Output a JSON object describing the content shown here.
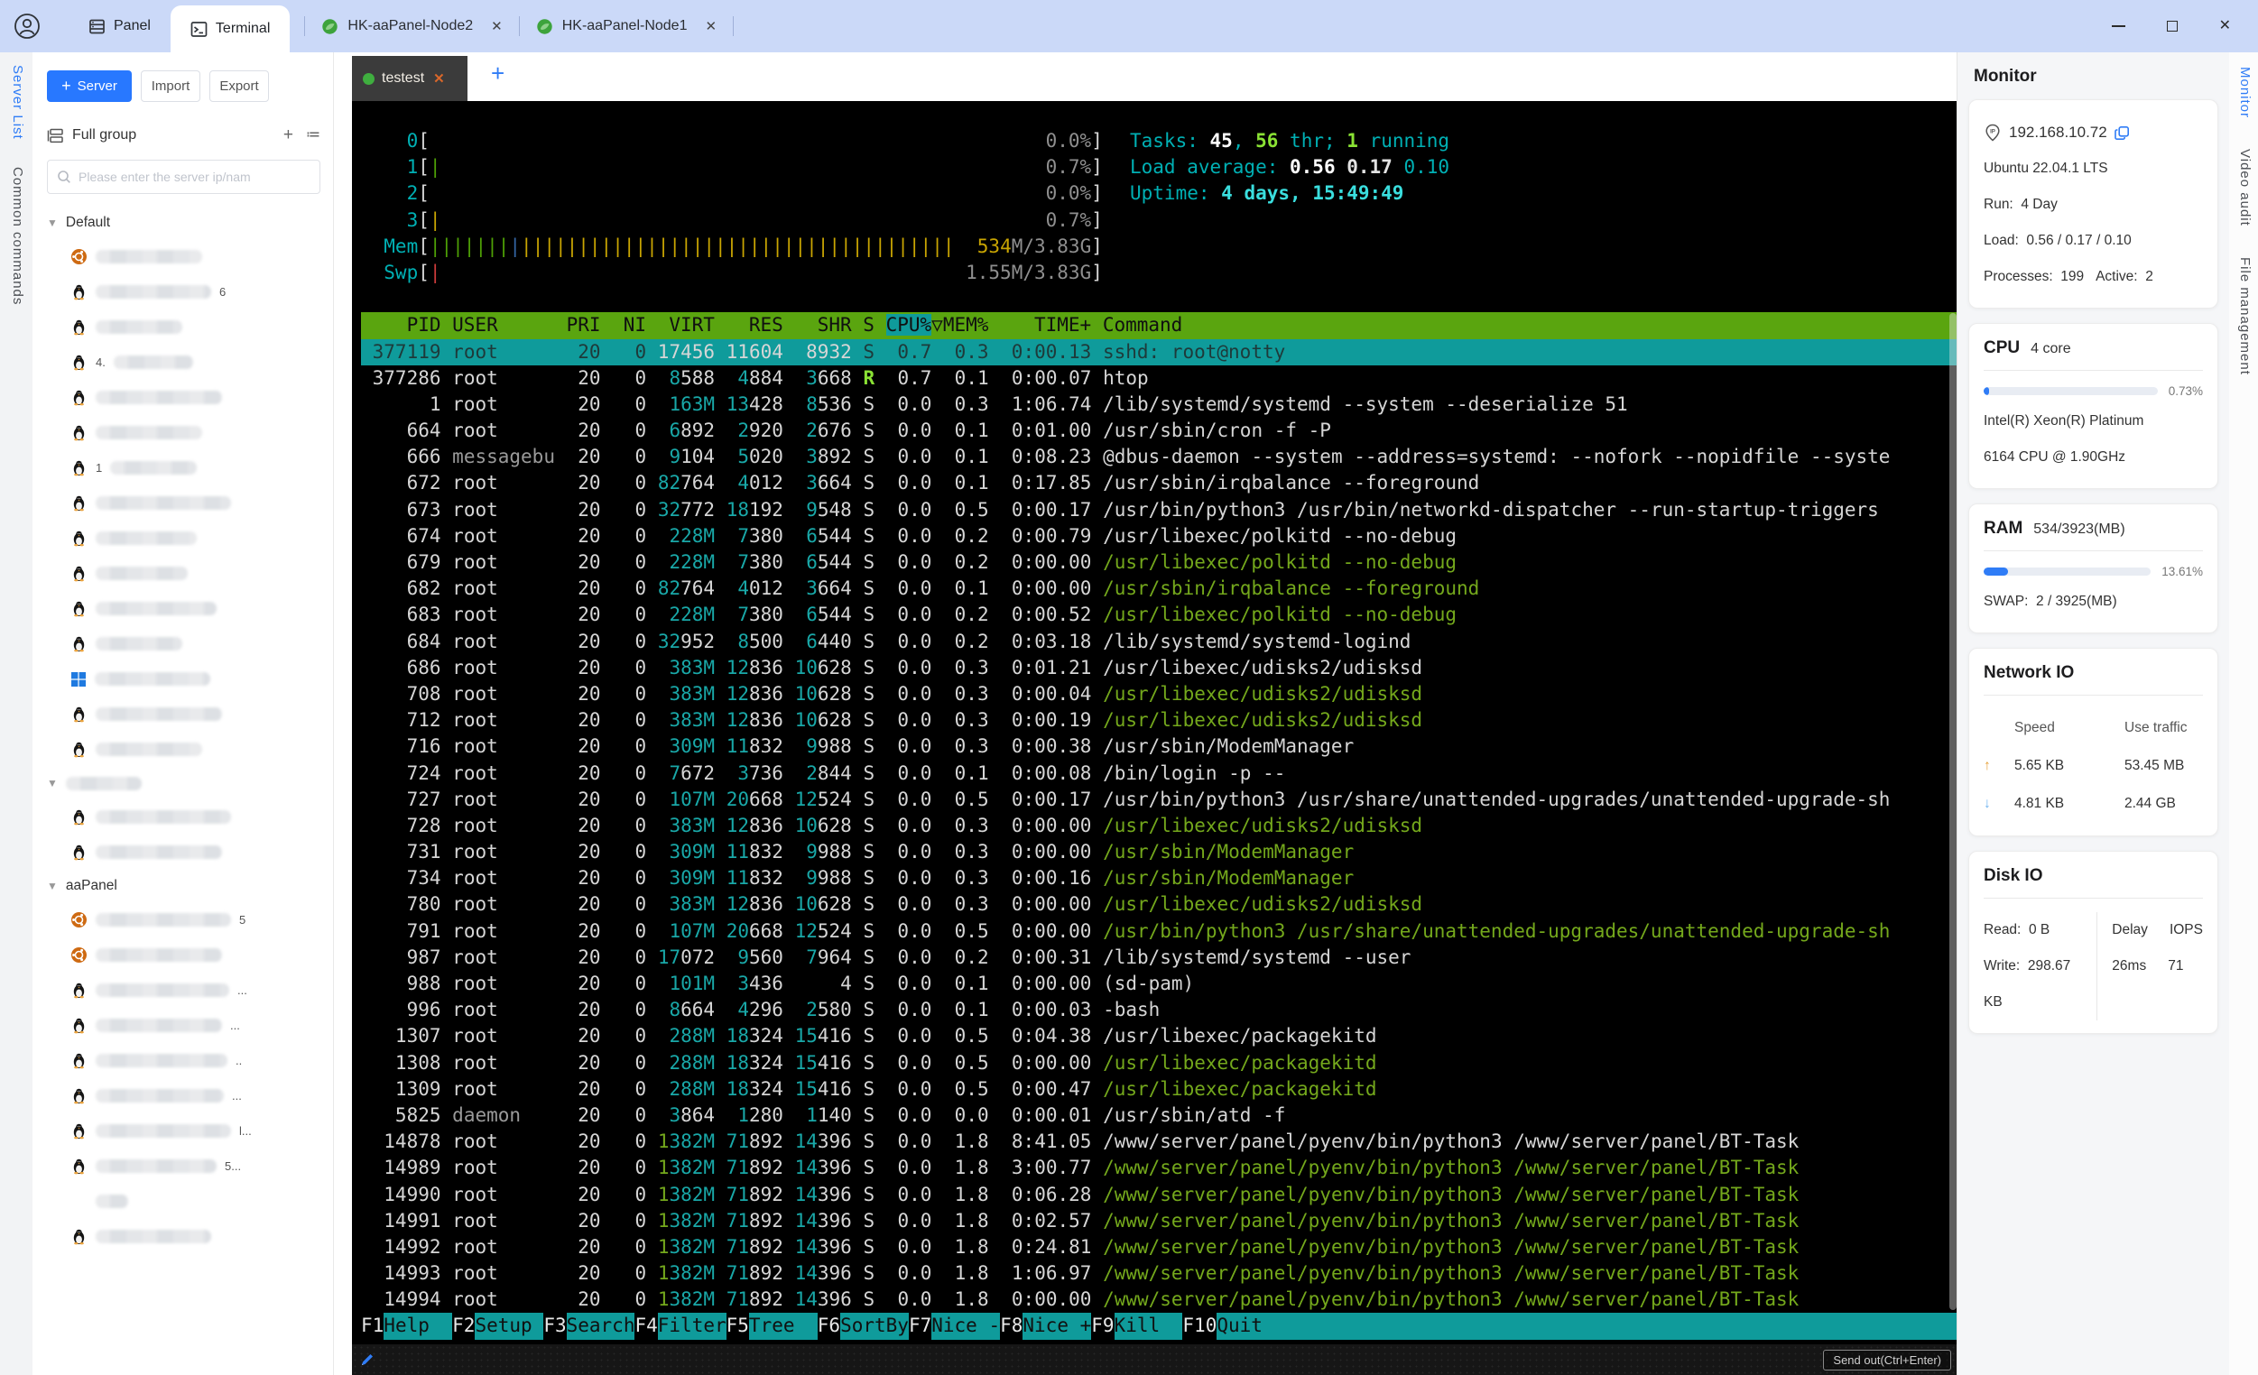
{
  "colors": {
    "topbar": "#cbd9f8",
    "accent_blue": "#2878ff",
    "link_blue": "#2f7cf6",
    "header_green": "#5aa50f",
    "select_teal": "#0f9b9b",
    "term_cyan": "#00b0b4",
    "term_green": "#74a81c",
    "term_teal": "#19a8a8",
    "term_yellow": "#c9a502"
  },
  "top_bar": {
    "panel_label": "Panel",
    "terminal_label": "Terminal",
    "session_tabs": [
      {
        "label": "HK-aaPanel-Node2"
      },
      {
        "label": "HK-aaPanel-Node1"
      }
    ]
  },
  "left_rail": {
    "server_list": "Server List",
    "common_commands": "Common commands"
  },
  "sidebar": {
    "add_server": "Server",
    "import": "Import",
    "export": "Export",
    "group_filter": "Full group",
    "search_placeholder": "Please enter the server ip/nam",
    "groups": [
      {
        "name": "Default",
        "items": [
          {
            "icon": "ubuntu",
            "w": 118
          },
          {
            "icon": "linux",
            "w": 128,
            "suffix": "6"
          },
          {
            "icon": "linux",
            "w": 96
          },
          {
            "icon": "linux",
            "w": 88,
            "prefix": "4."
          },
          {
            "icon": "linux",
            "w": 140
          },
          {
            "icon": "linux",
            "w": 118
          },
          {
            "icon": "linux",
            "w": 96,
            "prefix": "1"
          },
          {
            "icon": "linux",
            "w": 150
          },
          {
            "icon": "linux",
            "w": 112
          },
          {
            "icon": "linux",
            "w": 102
          },
          {
            "icon": "linux",
            "w": 134
          },
          {
            "icon": "linux",
            "w": 96
          },
          {
            "icon": "windows",
            "w": 128
          },
          {
            "icon": "linux",
            "w": 140
          },
          {
            "icon": "linux",
            "w": 118
          }
        ]
      },
      {
        "name": "",
        "redacted": true,
        "name_w": 84,
        "items": [
          {
            "icon": "linux",
            "w": 150
          },
          {
            "icon": "linux",
            "w": 140
          }
        ]
      },
      {
        "name": "aaPanel",
        "items": [
          {
            "icon": "ubuntu",
            "w": 150,
            "suffix": "5"
          },
          {
            "icon": "ubuntu",
            "w": 140
          },
          {
            "icon": "linux",
            "w": 148,
            "suffix": "..."
          },
          {
            "icon": "linux",
            "w": 140,
            "suffix": "..."
          },
          {
            "icon": "linux",
            "w": 146,
            "suffix": ".."
          },
          {
            "icon": "linux",
            "w": 142,
            "suffix": "..."
          },
          {
            "icon": "linux",
            "w": 150,
            "suffix": "l..."
          },
          {
            "icon": "linux",
            "w": 134,
            "suffix": "5..."
          },
          {
            "icon": "none",
            "w": 36
          },
          {
            "icon": "linux",
            "w": 128
          }
        ]
      }
    ]
  },
  "terminal": {
    "tab_name": "testest",
    "add_tab": "+",
    "send_button": "Send out(Ctrl+Enter)"
  },
  "htop": {
    "meters": [
      {
        "label": "0",
        "bars": [],
        "value": [
          [
            "0.0%",
            "c-gray"
          ]
        ]
      },
      {
        "label": "1",
        "bars": [
          [
            "b-g",
            1
          ]
        ],
        "value": [
          [
            "0.7%",
            "c-gray"
          ]
        ]
      },
      {
        "label": "2",
        "bars": [],
        "value": [
          [
            "0.0%",
            "c-gray"
          ]
        ]
      },
      {
        "label": "3",
        "bars": [
          [
            "b-y",
            1
          ]
        ],
        "value": [
          [
            "0.7%",
            "c-gray"
          ]
        ]
      },
      {
        "label": "Mem",
        "bars": [
          [
            "b-g",
            7
          ],
          [
            "b-b",
            1
          ],
          [
            "b-y",
            38
          ]
        ],
        "value": [
          [
            "534",
            "c-y"
          ],
          [
            "M/3.83G",
            "c-gray"
          ]
        ]
      },
      {
        "label": "Swp",
        "bars": [
          [
            "b-r",
            1
          ]
        ],
        "value": [
          [
            "1.55M/3.83G",
            "c-gray"
          ]
        ]
      }
    ],
    "tasks_line": [
      [
        "Tasks: ",
        "c-cyan"
      ],
      [
        "45",
        "c-wb"
      ],
      [
        ", ",
        "c-cyan"
      ],
      [
        "56",
        "c-bg"
      ],
      [
        " thr; ",
        "c-cyan"
      ],
      [
        "1",
        "c-bg"
      ],
      [
        " running",
        "c-cyan"
      ]
    ],
    "load_line": [
      [
        "Load average: ",
        "c-cyan"
      ],
      [
        "0.56 ",
        "c-wb"
      ],
      [
        "0.17 ",
        "c-w2b"
      ],
      [
        "0.10",
        "c-cyan"
      ]
    ],
    "uptime_line": [
      [
        "Uptime: ",
        "c-cyan"
      ],
      [
        "4 days, 15:49:49",
        "c-bcyan"
      ]
    ],
    "columns": [
      "PID",
      "USER",
      "PRI",
      "NI",
      "VIRT",
      "RES",
      "SHR",
      "S",
      "CPU%",
      "MEM%",
      "TIME+",
      "Command"
    ],
    "sort_column": "CPU%",
    "processes": [
      [
        "377119",
        "root",
        "20",
        "0",
        "17456",
        "11604",
        "8932",
        "S",
        "0.7",
        "0.3",
        "0:00.13",
        "sshd: root@notty",
        "sel"
      ],
      [
        "377286",
        "root",
        "20",
        "0",
        "8588",
        "4884",
        "3668",
        "R",
        "0.7",
        "0.1",
        "0:00.07",
        "htop",
        ""
      ],
      [
        "1",
        "root",
        "20",
        "0",
        "163M",
        "13428",
        "8536",
        "S",
        "0.0",
        "0.3",
        "1:06.74",
        "/lib/systemd/systemd --system --deserialize 51",
        ""
      ],
      [
        "664",
        "root",
        "20",
        "0",
        "6892",
        "2920",
        "2676",
        "S",
        "0.0",
        "0.1",
        "0:01.00",
        "/usr/sbin/cron -f -P",
        ""
      ],
      [
        "666",
        "messagebu",
        "20",
        "0",
        "9104",
        "5020",
        "3892",
        "S",
        "0.0",
        "0.1",
        "0:08.23",
        "@dbus-daemon --system --address=systemd: --nofork --nopidfile --syste",
        "ud"
      ],
      [
        "672",
        "root",
        "20",
        "0",
        "82764",
        "4012",
        "3664",
        "S",
        "0.0",
        "0.1",
        "0:17.85",
        "/usr/sbin/irqbalance --foreground",
        ""
      ],
      [
        "673",
        "root",
        "20",
        "0",
        "32772",
        "18192",
        "9548",
        "S",
        "0.0",
        "0.5",
        "0:00.17",
        "/usr/bin/python3 /usr/bin/networkd-dispatcher --run-startup-triggers",
        ""
      ],
      [
        "674",
        "root",
        "20",
        "0",
        "228M",
        "7380",
        "6544",
        "S",
        "0.0",
        "0.2",
        "0:00.79",
        "/usr/libexec/polkitd --no-debug",
        ""
      ],
      [
        "679",
        "root",
        "20",
        "0",
        "228M",
        "7380",
        "6544",
        "S",
        "0.0",
        "0.2",
        "0:00.00",
        "/usr/libexec/polkitd --no-debug",
        "g"
      ],
      [
        "682",
        "root",
        "20",
        "0",
        "82764",
        "4012",
        "3664",
        "S",
        "0.0",
        "0.1",
        "0:00.00",
        "/usr/sbin/irqbalance --foreground",
        "g"
      ],
      [
        "683",
        "root",
        "20",
        "0",
        "228M",
        "7380",
        "6544",
        "S",
        "0.0",
        "0.2",
        "0:00.52",
        "/usr/libexec/polkitd --no-debug",
        "g"
      ],
      [
        "684",
        "root",
        "20",
        "0",
        "32952",
        "8500",
        "6440",
        "S",
        "0.0",
        "0.2",
        "0:03.18",
        "/lib/systemd/systemd-logind",
        ""
      ],
      [
        "686",
        "root",
        "20",
        "0",
        "383M",
        "12836",
        "10628",
        "S",
        "0.0",
        "0.3",
        "0:01.21",
        "/usr/libexec/udisks2/udisksd",
        ""
      ],
      [
        "708",
        "root",
        "20",
        "0",
        "383M",
        "12836",
        "10628",
        "S",
        "0.0",
        "0.3",
        "0:00.04",
        "/usr/libexec/udisks2/udisksd",
        "g"
      ],
      [
        "712",
        "root",
        "20",
        "0",
        "383M",
        "12836",
        "10628",
        "S",
        "0.0",
        "0.3",
        "0:00.19",
        "/usr/libexec/udisks2/udisksd",
        "g"
      ],
      [
        "716",
        "root",
        "20",
        "0",
        "309M",
        "11832",
        "9988",
        "S",
        "0.0",
        "0.3",
        "0:00.38",
        "/usr/sbin/ModemManager",
        ""
      ],
      [
        "724",
        "root",
        "20",
        "0",
        "7672",
        "3736",
        "2844",
        "S",
        "0.0",
        "0.1",
        "0:00.08",
        "/bin/login -p --",
        ""
      ],
      [
        "727",
        "root",
        "20",
        "0",
        "107M",
        "20668",
        "12524",
        "S",
        "0.0",
        "0.5",
        "0:00.17",
        "/usr/bin/python3 /usr/share/unattended-upgrades/unattended-upgrade-sh",
        ""
      ],
      [
        "728",
        "root",
        "20",
        "0",
        "383M",
        "12836",
        "10628",
        "S",
        "0.0",
        "0.3",
        "0:00.00",
        "/usr/libexec/udisks2/udisksd",
        "g"
      ],
      [
        "731",
        "root",
        "20",
        "0",
        "309M",
        "11832",
        "9988",
        "S",
        "0.0",
        "0.3",
        "0:00.00",
        "/usr/sbin/ModemManager",
        "g"
      ],
      [
        "734",
        "root",
        "20",
        "0",
        "309M",
        "11832",
        "9988",
        "S",
        "0.0",
        "0.3",
        "0:00.16",
        "/usr/sbin/ModemManager",
        "g"
      ],
      [
        "780",
        "root",
        "20",
        "0",
        "383M",
        "12836",
        "10628",
        "S",
        "0.0",
        "0.3",
        "0:00.00",
        "/usr/libexec/udisks2/udisksd",
        "g"
      ],
      [
        "791",
        "root",
        "20",
        "0",
        "107M",
        "20668",
        "12524",
        "S",
        "0.0",
        "0.5",
        "0:00.00",
        "/usr/bin/python3 /usr/share/unattended-upgrades/unattended-upgrade-sh",
        "g"
      ],
      [
        "987",
        "root",
        "20",
        "0",
        "17072",
        "9560",
        "7964",
        "S",
        "0.0",
        "0.2",
        "0:00.31",
        "/lib/systemd/systemd --user",
        ""
      ],
      [
        "988",
        "root",
        "20",
        "0",
        "101M",
        "3436",
        "4",
        "S",
        "0.0",
        "0.1",
        "0:00.00",
        "(sd-pam)",
        ""
      ],
      [
        "996",
        "root",
        "20",
        "0",
        "8664",
        "4296",
        "2580",
        "S",
        "0.0",
        "0.1",
        "0:00.03",
        "-bash",
        ""
      ],
      [
        "1307",
        "root",
        "20",
        "0",
        "288M",
        "18324",
        "15416",
        "S",
        "0.0",
        "0.5",
        "0:04.38",
        "/usr/libexec/packagekitd",
        ""
      ],
      [
        "1308",
        "root",
        "20",
        "0",
        "288M",
        "18324",
        "15416",
        "S",
        "0.0",
        "0.5",
        "0:00.00",
        "/usr/libexec/packagekitd",
        "g"
      ],
      [
        "1309",
        "root",
        "20",
        "0",
        "288M",
        "18324",
        "15416",
        "S",
        "0.0",
        "0.5",
        "0:00.47",
        "/usr/libexec/packagekitd",
        "g"
      ],
      [
        "5825",
        "daemon",
        "20",
        "0",
        "3864",
        "1280",
        "1140",
        "S",
        "0.0",
        "0.0",
        "0:00.01",
        "/usr/sbin/atd -f",
        "ud"
      ],
      [
        "14878",
        "root",
        "20",
        "0",
        "1382M",
        "71892",
        "14396",
        "S",
        "0.0",
        "1.8",
        "8:41.05",
        "/www/server/panel/pyenv/bin/python3 /www/server/panel/BT-Task",
        ""
      ],
      [
        "14989",
        "root",
        "20",
        "0",
        "1382M",
        "71892",
        "14396",
        "S",
        "0.0",
        "1.8",
        "3:00.77",
        "/www/server/panel/pyenv/bin/python3 /www/server/panel/BT-Task",
        "g"
      ],
      [
        "14990",
        "root",
        "20",
        "0",
        "1382M",
        "71892",
        "14396",
        "S",
        "0.0",
        "1.8",
        "0:06.28",
        "/www/server/panel/pyenv/bin/python3 /www/server/panel/BT-Task",
        "g"
      ],
      [
        "14991",
        "root",
        "20",
        "0",
        "1382M",
        "71892",
        "14396",
        "S",
        "0.0",
        "1.8",
        "0:02.57",
        "/www/server/panel/pyenv/bin/python3 /www/server/panel/BT-Task",
        "g"
      ],
      [
        "14992",
        "root",
        "20",
        "0",
        "1382M",
        "71892",
        "14396",
        "S",
        "0.0",
        "1.8",
        "0:24.81",
        "/www/server/panel/pyenv/bin/python3 /www/server/panel/BT-Task",
        "g"
      ],
      [
        "14993",
        "root",
        "20",
        "0",
        "1382M",
        "71892",
        "14396",
        "S",
        "0.0",
        "1.8",
        "1:06.97",
        "/www/server/panel/pyenv/bin/python3 /www/server/panel/BT-Task",
        "g"
      ],
      [
        "14994",
        "root",
        "20",
        "0",
        "1382M",
        "71892",
        "14396",
        "S",
        "0.0",
        "1.8",
        "0:00.00",
        "/www/server/panel/pyenv/bin/python3 /www/server/panel/BT-Task",
        "g"
      ]
    ],
    "fkeys": [
      [
        "F1",
        "Help"
      ],
      [
        "F2",
        "Setup"
      ],
      [
        "F3",
        "Search"
      ],
      [
        "F4",
        "Filter"
      ],
      [
        "F5",
        "Tree"
      ],
      [
        "F6",
        "SortBy"
      ],
      [
        "F7",
        "Nice -"
      ],
      [
        "F8",
        "Nice +"
      ],
      [
        "F9",
        "Kill"
      ],
      [
        "F10",
        "Quit"
      ]
    ]
  },
  "monitor": {
    "title": "Monitor",
    "server": {
      "ip": "192.168.10.72",
      "os": "Ubuntu 22.04.1 LTS",
      "run_label": "Run:",
      "run_value": "4 Day",
      "load_label": "Load:",
      "load_value": "0.56 / 0.17 / 0.10",
      "processes_label": "Processes:",
      "processes_value": "199",
      "active_label": "Active:",
      "active_value": "2"
    },
    "cpu": {
      "title": "CPU",
      "cores": "4 core",
      "usage_pct": "0.73%",
      "usage_ratio": 0.0073,
      "model_line1": "Intel(R) Xeon(R) Platinum",
      "model_line2": "6164 CPU @ 1.90GHz"
    },
    "ram": {
      "title": "RAM",
      "value": "534/3923(MB)",
      "usage_pct": "13.61%",
      "usage_ratio": 0.1361,
      "swap_label": "SWAP:",
      "swap_value": "2 / 3925(MB)"
    },
    "network": {
      "title": "Network IO",
      "speed_header": "Speed",
      "traffic_header": "Use traffic",
      "up_speed": "5.65 KB",
      "up_traffic": "53.45 MB",
      "down_speed": "4.81 KB",
      "down_traffic": "2.44 GB"
    },
    "disk": {
      "title": "Disk IO",
      "read_label": "Read:",
      "read_value": "0 B",
      "write_label": "Write:",
      "write_value": "298.67",
      "write_unit": "KB",
      "delay_header": "Delay",
      "iops_header": "IOPS",
      "delay_value": "26ms",
      "iops_value": "71"
    }
  },
  "right_rail": {
    "tabs": [
      {
        "label": "Monitor",
        "active": true
      },
      {
        "label": "Video audit",
        "active": false
      },
      {
        "label": "File management",
        "active": false
      }
    ]
  }
}
